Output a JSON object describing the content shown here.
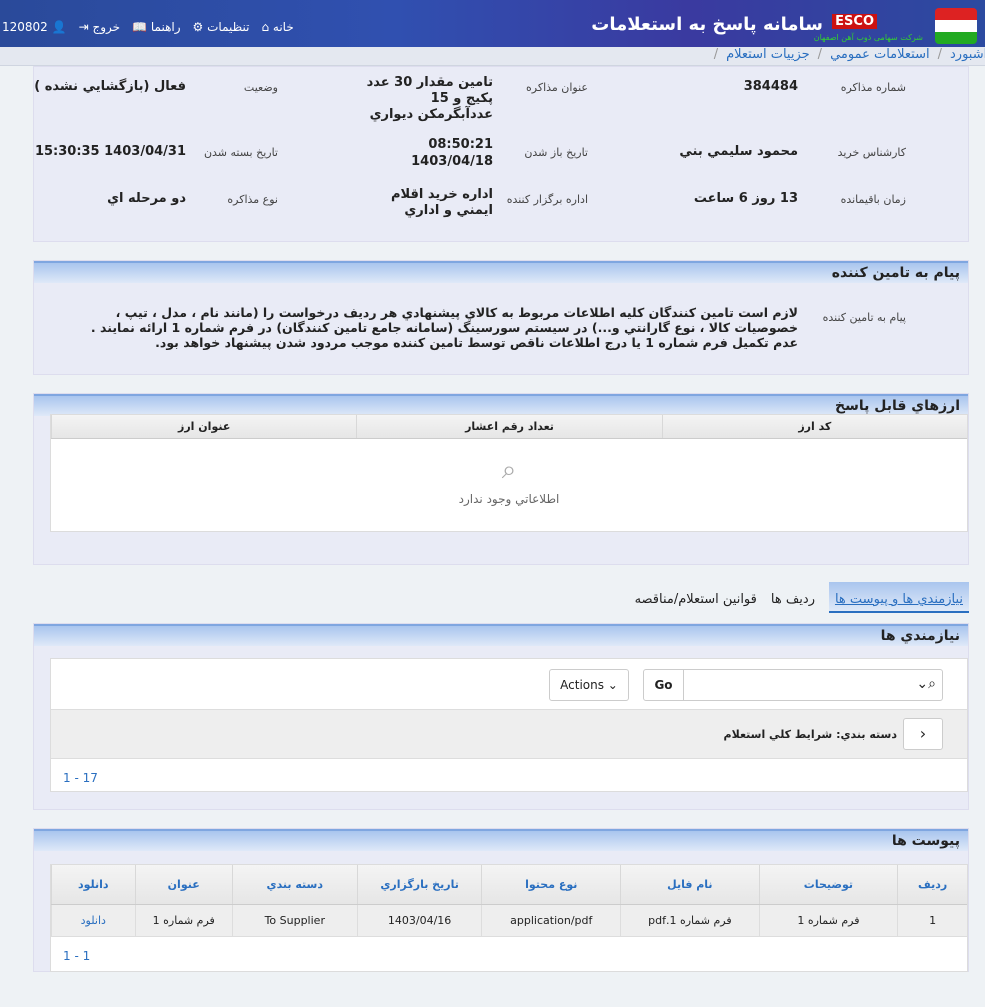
{
  "header": {
    "title": "سامانه پاسخ به استعلامات",
    "brand": "ESCO",
    "brand_sub": "شرکت سهامی ذوب آهن اصفهان",
    "menu": [
      {
        "label": "خانه",
        "icon": "home-icon"
      },
      {
        "label": "تنظيمات",
        "icon": "gear-icon"
      },
      {
        "label": "راهنما",
        "icon": "book-icon"
      },
      {
        "label": "خروج",
        "icon": "logout-icon"
      },
      {
        "label": "120802",
        "icon": "user-icon"
      }
    ]
  },
  "breadcrumb": [
    "داشبورد",
    "استعلامات عمومي",
    "جزييات استعلام"
  ],
  "info": {
    "number_label": "شماره مذاکره",
    "number": "384484",
    "subject_label": "عنوان مذاکره",
    "subject": "تامين مقدار 30 عدد پکيج و 15 عددآبگرمکن ديواري",
    "status_label": "وضعيت",
    "status": "فعال (بازگشايي نشده )",
    "expert_label": "کارشناس خريد",
    "expert": "محمود سليمي بني",
    "open_label": "تاريخ باز شدن",
    "open_time": "08:50:21",
    "open_date": "1403/04/18",
    "close_label": "تاريخ بسته شدن",
    "close": "1403/04/31 15:30:35",
    "remaining_label": "زمان باقيمانده",
    "remaining": "13 روز 6 ساعت",
    "dept_label": "اداره برگزار کننده",
    "dept": "اداره خريد اقلام ايمني و اداري",
    "type_label": "نوع مذاکره",
    "type": "دو مرحله اي"
  },
  "message": {
    "title": "پيام به تامين کننده",
    "label": "پيام به تامين کننده",
    "lines": [
      "لازم است تامين کنندگان کليه اطلاعات مربوط به کالاي پيشنهادي هر رديف درخواست را (مانند نام ، مدل ، تيپ ، خصوصيات کالا ، نوع گارانتي و...) در سيستم سورسينگ (سامانه جامع تامين کنندگان) در فرم شماره 1 ارائه نمايند .",
      "عدم تکميل فرم شماره 1 يا درج اطلاعات ناقص توسط تامين کننده موجب مردود شدن پيشنهاد خواهد بود."
    ]
  },
  "currency": {
    "title": "ارزهاي قابل پاسخ",
    "columns": [
      "کد ارز",
      "تعداد رقم اعشار",
      "عنوان ارز"
    ],
    "empty": "اطلاعاتي وجود ندارد"
  },
  "tabs": [
    "نيازمندي ها و پيوست ها",
    "رديف ها",
    "قوانين استعلام/مناقصه"
  ],
  "needs": {
    "title": "نيازمندي ها",
    "go": "Go",
    "actions": "Actions",
    "group": "دسته بندي: شرايط کلي استعلام",
    "pager": "1 - 17"
  },
  "attachments": {
    "title": "پيوست ها",
    "columns": [
      "رديف",
      "توضيحات",
      "نام فايل",
      "نوع محتوا",
      "تاريخ بارگزاري",
      "دسته بندي",
      "عنوان",
      "دانلود"
    ],
    "rows": [
      [
        "1",
        "فرم شماره 1",
        "فرم شماره 1.pdf",
        "application/pdf",
        "1403/04/16",
        "To Supplier",
        "فرم شماره 1",
        "دانلود"
      ]
    ],
    "pager": "1 - 1"
  }
}
